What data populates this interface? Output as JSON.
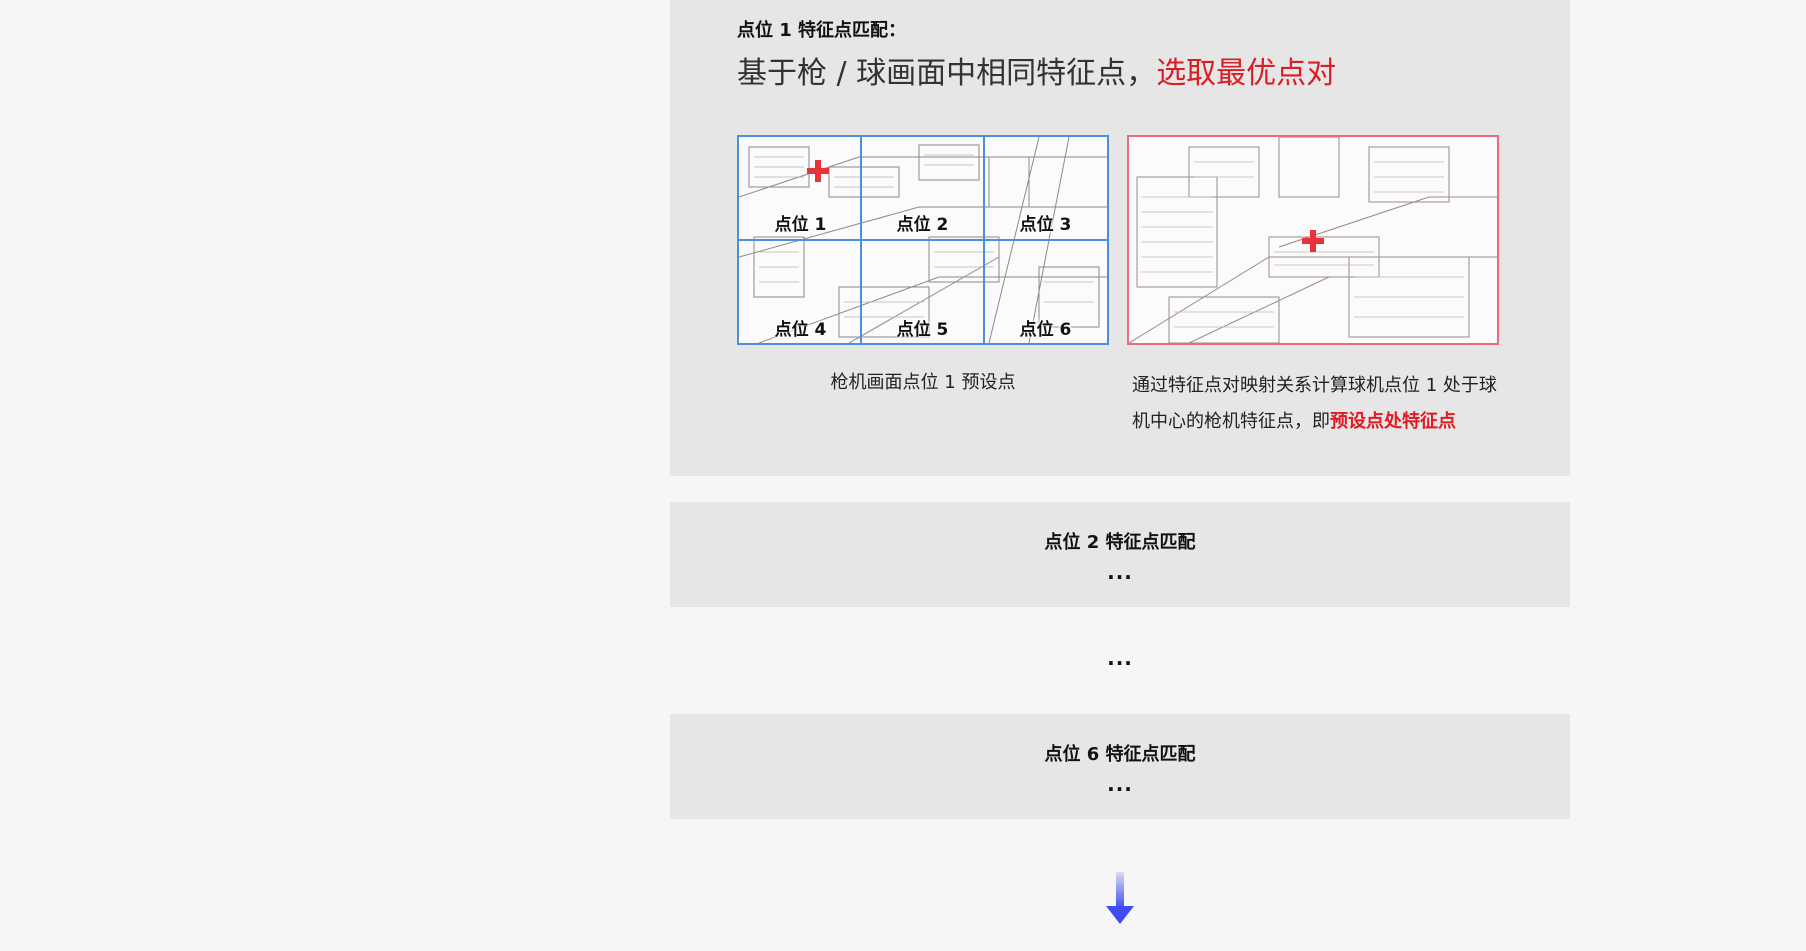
{
  "step1": {
    "title": "点位 1 特征点匹配：",
    "headline_prefix": "基于枪 / 球画面中相同特征点，",
    "headline_highlight": "选取最优点对",
    "cells": [
      "点位 1",
      "点位 2",
      "点位 3",
      "点位 4",
      "点位 5",
      "点位 6"
    ],
    "caption_left": "枪机画面点位 1 预设点",
    "caption_right_prefix": "通过特征点对映射关系计算球机点位 1 处于球机中心的枪机特征点，即",
    "caption_right_highlight": "预设点处特征点"
  },
  "step2": {
    "title": "点位 2 特征点匹配",
    "ellipsis": "..."
  },
  "middle_ellipsis": "...",
  "step6": {
    "title": "点位 6 特征点匹配",
    "ellipsis": "..."
  },
  "colors": {
    "highlight_red": "#d91f26",
    "grid_blue": "#4a8ee0",
    "frame_pink": "#ef6a7a",
    "arrow_blue": "#3f4cf3",
    "panel_bg": "#e6e6e6",
    "page_bg": "#f6f6f6"
  },
  "icons": {
    "marker": "red-cross-marker-icon",
    "next_step": "down-arrow-icon"
  }
}
